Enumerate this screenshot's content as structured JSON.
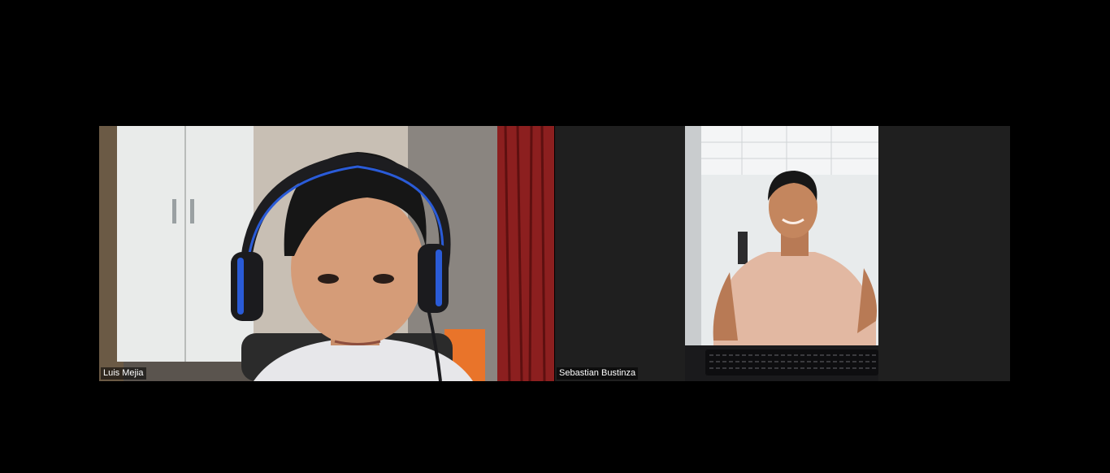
{
  "meeting": {
    "participants": [
      {
        "name": "Luis Mejia",
        "video": "camera-feed"
      },
      {
        "name": "Sebastian Bustinza",
        "video": "camera-feed"
      }
    ]
  },
  "colors": {
    "background": "#000000",
    "tile_empty": "#1f1f1f",
    "headset_accent": "#2a5bd7",
    "curtain": "#8c1f1f"
  }
}
